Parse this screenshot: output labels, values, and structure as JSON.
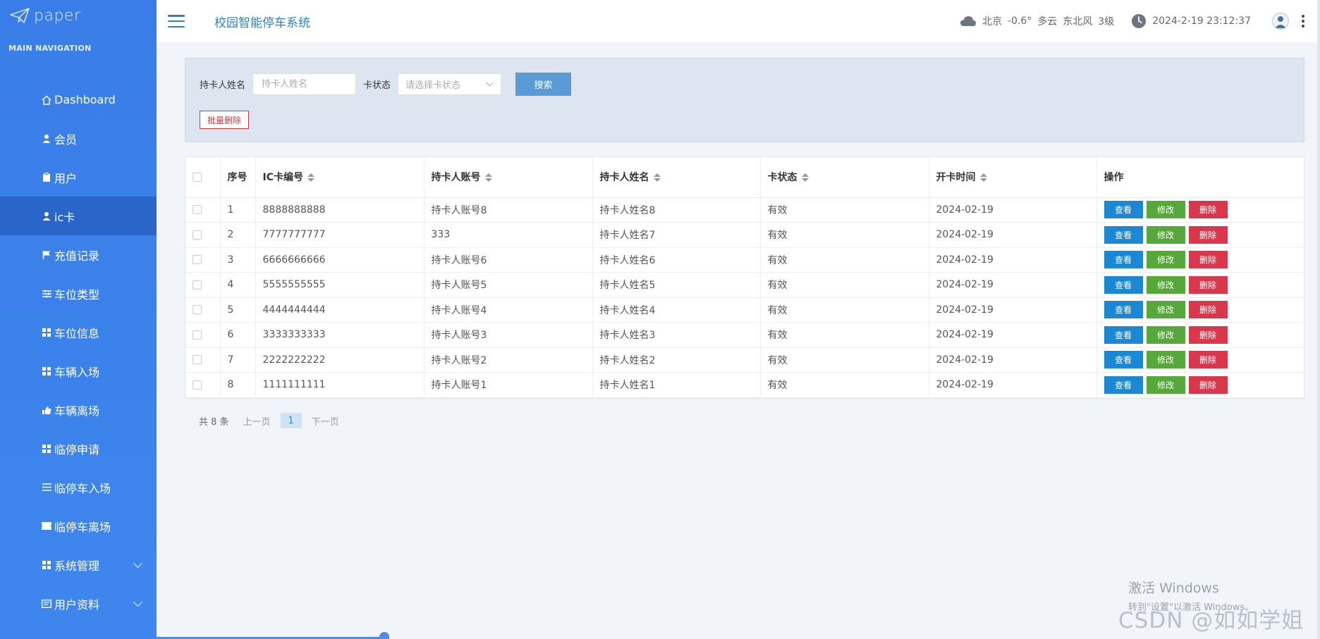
{
  "logo": {
    "text": "paper"
  },
  "nav": {
    "heading": "MAIN NAVIGATION",
    "items": [
      {
        "label": "Dashboard",
        "icon": "home-icon"
      },
      {
        "label": "会员",
        "icon": "user-icon"
      },
      {
        "label": "用户",
        "icon": "clipboard-icon"
      },
      {
        "label": "ic卡",
        "icon": "user-icon",
        "active": true
      },
      {
        "label": "充值记录",
        "icon": "flag-icon"
      },
      {
        "label": "车位类型",
        "icon": "sliders-icon"
      },
      {
        "label": "车位信息",
        "icon": "grid-icon"
      },
      {
        "label": "车辆入场",
        "icon": "grid-icon"
      },
      {
        "label": "车辆离场",
        "icon": "hand-icon"
      },
      {
        "label": "临停申请",
        "icon": "grid-icon"
      },
      {
        "label": "临停车入场",
        "icon": "list-icon"
      },
      {
        "label": "临停车离场",
        "icon": "ticket-icon"
      },
      {
        "label": "系统管理",
        "icon": "grid-icon",
        "expandable": true
      },
      {
        "label": "用户资料",
        "icon": "id-card-icon",
        "expandable": true
      }
    ]
  },
  "header": {
    "title": "校园智能停车系统",
    "weather": {
      "city": "北京",
      "temp": "-0.6°",
      "condition": "多云",
      "wind": "东北风",
      "level": "3级"
    },
    "datetime": "2024-2-19 23:12:37"
  },
  "search": {
    "name_label": "持卡人姓名",
    "name_placeholder": "持卡人姓名",
    "status_label": "卡状态",
    "status_placeholder": "请选择卡状态",
    "search_button": "搜索",
    "batch_delete": "批量删除"
  },
  "table": {
    "headers": [
      "序号",
      "IC卡编号",
      "持卡人账号",
      "持卡人姓名",
      "卡状态",
      "开卡时间",
      "操作"
    ],
    "rows": [
      {
        "idx": "1",
        "card": "8888888888",
        "account": "持卡人账号8",
        "name": "持卡人姓名8",
        "status": "有效",
        "date": "2024-02-19"
      },
      {
        "idx": "2",
        "card": "7777777777",
        "account": "333",
        "name": "持卡人姓名7",
        "status": "有效",
        "date": "2024-02-19"
      },
      {
        "idx": "3",
        "card": "6666666666",
        "account": "持卡人账号6",
        "name": "持卡人姓名6",
        "status": "有效",
        "date": "2024-02-19"
      },
      {
        "idx": "4",
        "card": "5555555555",
        "account": "持卡人账号5",
        "name": "持卡人姓名5",
        "status": "有效",
        "date": "2024-02-19"
      },
      {
        "idx": "5",
        "card": "4444444444",
        "account": "持卡人账号4",
        "name": "持卡人姓名4",
        "status": "有效",
        "date": "2024-02-19"
      },
      {
        "idx": "6",
        "card": "3333333333",
        "account": "持卡人账号3",
        "name": "持卡人姓名3",
        "status": "有效",
        "date": "2024-02-19"
      },
      {
        "idx": "7",
        "card": "2222222222",
        "account": "持卡人账号2",
        "name": "持卡人姓名2",
        "status": "有效",
        "date": "2024-02-19"
      },
      {
        "idx": "8",
        "card": "1111111111",
        "account": "持卡人账号1",
        "name": "持卡人姓名1",
        "status": "有效",
        "date": "2024-02-19"
      }
    ],
    "actions": {
      "view": "查看",
      "edit": "修改",
      "delete": "删除"
    }
  },
  "pager": {
    "total": "共 8 条",
    "prev": "上一页",
    "page": "1",
    "next": "下一页"
  },
  "watermark": {
    "win_line1": "激活 Windows",
    "win_line2": "转到\"设置\"以激活 Windows。",
    "csdn": "CSDN @如如学姐"
  },
  "colors": {
    "sidebar": "#3a7de8",
    "active": "#2a66c9",
    "view": "#1c87d3",
    "edit": "#57a83a",
    "delete": "#d9384c",
    "search": "#5b9bd5"
  }
}
